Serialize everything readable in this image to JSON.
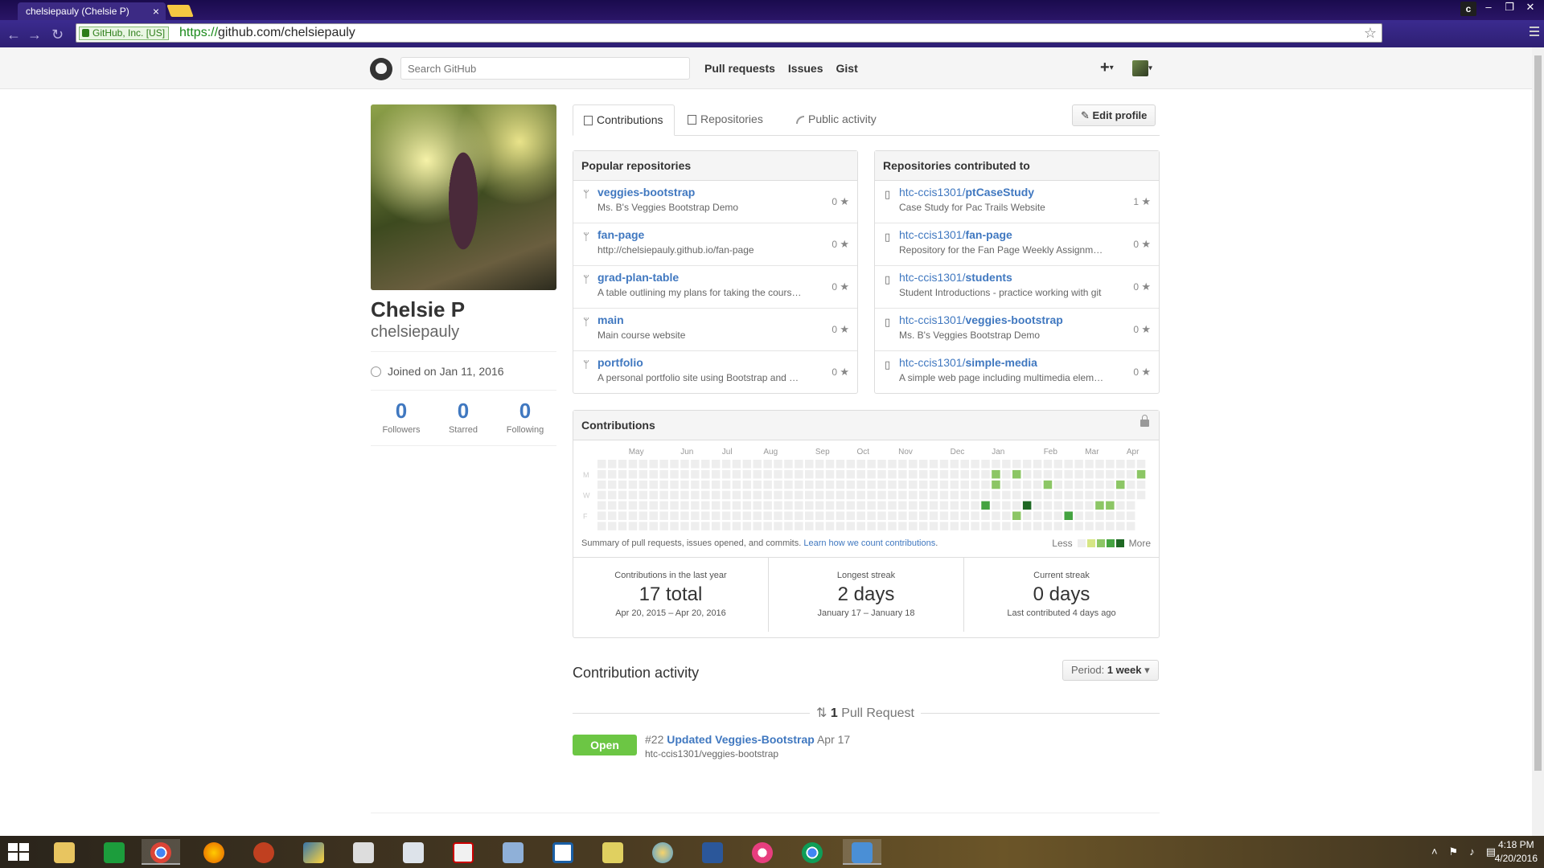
{
  "browser": {
    "tab_title": "chelsiepauly (Chelsie P)",
    "tab_close": "×",
    "security_label": "GitHub, Inc. [US]",
    "url_scheme": "https://",
    "url_rest": "github.com/chelsiepauly",
    "profile_button": "c"
  },
  "header": {
    "search_placeholder": "Search GitHub",
    "nav": [
      "Pull requests",
      "Issues",
      "Gist"
    ],
    "plus": "+"
  },
  "profile": {
    "fullname": "Chelsie P",
    "username": "chelsiepauly",
    "joined": "Joined on Jan 11, 2016",
    "stats": [
      {
        "count": "0",
        "label": "Followers"
      },
      {
        "count": "0",
        "label": "Starred"
      },
      {
        "count": "0",
        "label": "Following"
      }
    ]
  },
  "tabs": [
    "Contributions",
    "Repositories",
    "Public activity"
  ],
  "edit_profile": "Edit profile",
  "popular": {
    "title": "Popular repositories",
    "repos": [
      {
        "name": "veggies-bootstrap",
        "desc": "Ms. B's Veggies Bootstrap Demo",
        "stars": "0"
      },
      {
        "name": "fan-page",
        "desc": "http://chelsiepauly.github.io/fan-page",
        "stars": "0"
      },
      {
        "name": "grad-plan-table",
        "desc": "A table outlining my plans for taking the cours…",
        "stars": "0"
      },
      {
        "name": "main",
        "desc": "Main course website",
        "stars": "0"
      },
      {
        "name": "portfolio",
        "desc": "A personal portfolio site using Bootstrap and …",
        "stars": "0"
      }
    ]
  },
  "contributed": {
    "title": "Repositories contributed to",
    "repos": [
      {
        "owner": "htc-ccis1301/",
        "name": "ptCaseStudy",
        "desc": "Case Study for Pac Trails Website",
        "stars": "1"
      },
      {
        "owner": "htc-ccis1301/",
        "name": "fan-page",
        "desc": "Repository for the Fan Page Weekly Assignm…",
        "stars": "0"
      },
      {
        "owner": "htc-ccis1301/",
        "name": "students",
        "desc": "Student Introductions - practice working with git",
        "stars": "0"
      },
      {
        "owner": "htc-ccis1301/",
        "name": "veggies-bootstrap",
        "desc": "Ms. B's Veggies Bootstrap Demo",
        "stars": "0"
      },
      {
        "owner": "htc-ccis1301/",
        "name": "simple-media",
        "desc": "A simple web page including multimedia elem…",
        "stars": "0"
      }
    ]
  },
  "contributions": {
    "title": "Contributions",
    "months": [
      "May",
      "Jun",
      "Jul",
      "Aug",
      "Sep",
      "Oct",
      "Nov",
      "Dec",
      "Jan",
      "Feb",
      "Mar",
      "Apr"
    ],
    "days": [
      "M",
      "W",
      "F"
    ],
    "summary": "Summary of pull requests, issues opened, and commits.",
    "learn_link": "Learn how we count contributions",
    "legend_less": "Less",
    "legend_more": "More",
    "colors": [
      "#eeeeee",
      "#d6e685",
      "#8cc665",
      "#44a340",
      "#1e6823"
    ],
    "active_cells": [
      {
        "week": 40,
        "day": 1,
        "level": 2
      },
      {
        "week": 40,
        "day": 2,
        "level": 2
      },
      {
        "week": 39,
        "day": 4,
        "level": 3
      },
      {
        "week": 42,
        "day": 1,
        "level": 2
      },
      {
        "week": 42,
        "day": 5,
        "level": 2
      },
      {
        "week": 43,
        "day": 4,
        "level": 4
      },
      {
        "week": 45,
        "day": 2,
        "level": 2
      },
      {
        "week": 46,
        "day": 7,
        "level": 2
      },
      {
        "week": 47,
        "day": 5,
        "level": 3
      },
      {
        "week": 50,
        "day": 4,
        "level": 2
      },
      {
        "week": 51,
        "day": 4,
        "level": 2
      },
      {
        "week": 52,
        "day": 2,
        "level": 2
      },
      {
        "week": 54,
        "day": 1,
        "level": 2
      }
    ]
  },
  "summary_stats": [
    {
      "label": "Contributions in the last year",
      "value": "17 total",
      "range": "Apr 20, 2015 – Apr 20, 2016"
    },
    {
      "label": "Longest streak",
      "value": "2 days",
      "range": "January 17 – January 18"
    },
    {
      "label": "Current streak",
      "value": "0 days",
      "range": "Last contributed 4 days ago"
    }
  ],
  "activity": {
    "title": "Contribution activity",
    "period_label": "Period:",
    "period_value": "1 week",
    "pr_count": "1",
    "pr_label": "Pull Request",
    "pr_state": "Open",
    "pr_number": "#22",
    "pr_title": "Updated Veggies-Bootstrap",
    "pr_date": "Apr 17",
    "pr_repo": "htc-ccis1301/veggies-bootstrap"
  },
  "taskbar": {
    "time": "4:18 PM",
    "date": "4/20/2016"
  }
}
